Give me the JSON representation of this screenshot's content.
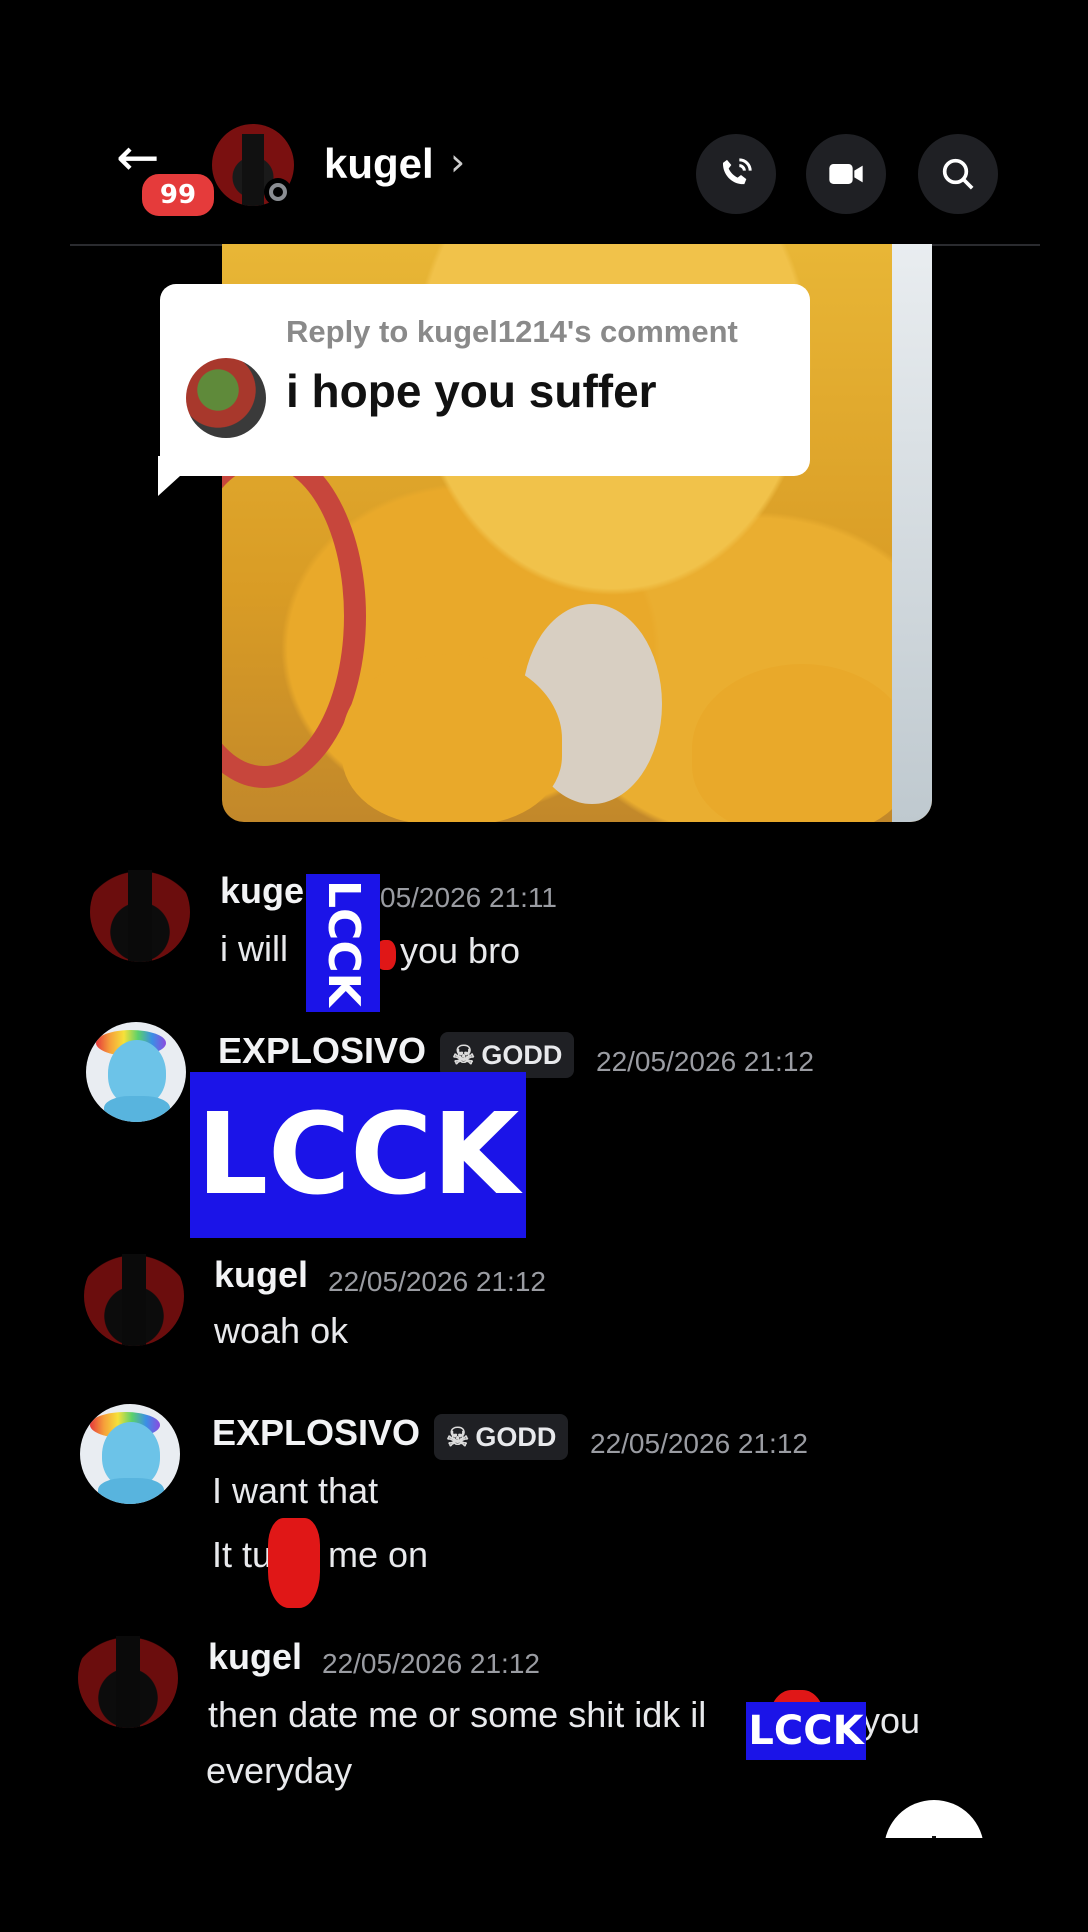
{
  "header": {
    "unread_count": "99",
    "contact_name": "kugel",
    "chevron": "›",
    "icons": [
      "back-arrow-icon",
      "phone-icon",
      "video-camera-icon",
      "search-icon"
    ]
  },
  "reply": {
    "heading": "Reply to kugel1214's comment",
    "text": "i hope you suffer"
  },
  "stamp_text": "LCCK",
  "messages": [
    {
      "author": "kugel",
      "time": "05/2026 21:11",
      "lines": [
        "i will",
        "you bro"
      ]
    },
    {
      "author": "EXPLOSIVO",
      "tag": "GODD",
      "time": "22/05/2026 21:12"
    },
    {
      "author": "kugel",
      "time": "22/05/2026 21:12",
      "lines": [
        "woah ok"
      ]
    },
    {
      "author": "EXPLOSIVO",
      "tag": "GODD",
      "time": "22/05/2026 21:12",
      "lines": [
        "I want that",
        "It tu",
        "s me on"
      ]
    },
    {
      "author": "kugel",
      "time": "22/05/2026 21:12",
      "lines": [
        "then date me or some shit idk il",
        "you",
        "everyday"
      ]
    }
  ],
  "colors": {
    "background": "#000000",
    "stamp": "#1b14e8",
    "badge": "#e53b3b",
    "redaction": "#e01717"
  }
}
